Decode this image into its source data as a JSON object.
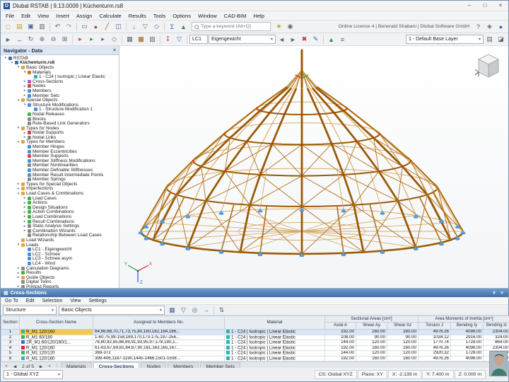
{
  "window": {
    "title": "Dlubal RSTAB | 9.13.0009 | Küchenturm.rs8",
    "logo": "D",
    "controls": [
      {
        "n": "minimize",
        "g": "–"
      },
      {
        "n": "maximize",
        "g": "□"
      },
      {
        "n": "close",
        "g": "×"
      }
    ]
  },
  "menu": [
    "File",
    "Edit",
    "View",
    "Insert",
    "Assign",
    "Calculate",
    "Results",
    "Tools",
    "Options",
    "Window",
    "CAD-BIM",
    "Help"
  ],
  "toolbar1": {
    "search_placeholder": "Type a keyword (Alt+Q)",
    "license": "Online License 4 | Benerald Shabani | Dlubal Software GmbH",
    "icons_left": [
      {
        "n": "new-model",
        "g": "□",
        "c": "#c8821e"
      },
      {
        "n": "open-model",
        "g": "▤",
        "c": "#c8a21e"
      },
      {
        "n": "save",
        "g": "▣",
        "c": "#46689a"
      },
      {
        "n": "print",
        "g": "▥",
        "c": "#5a6672"
      },
      {
        "n": "sep"
      },
      {
        "n": "undo",
        "g": "↶",
        "c": "#46689a"
      },
      {
        "n": "redo",
        "g": "↷",
        "c": "#9aa4ae"
      },
      {
        "n": "sep"
      },
      {
        "n": "select-objects",
        "g": "▭",
        "c": "#5a6672"
      },
      {
        "n": "new-node",
        "g": "●",
        "c": "#c04343"
      },
      {
        "n": "new-member",
        "g": "╱",
        "c": "#9a5c0a"
      },
      {
        "n": "new-section",
        "g": "◫",
        "c": "#46689a"
      },
      {
        "n": "sep"
      },
      {
        "n": "new-load",
        "g": "↓",
        "c": "#c04343"
      },
      {
        "n": "new-support",
        "g": "▽",
        "c": "#3a8a4a"
      },
      {
        "n": "new-hinge",
        "g": "◇",
        "c": "#46689a"
      },
      {
        "n": "sep"
      },
      {
        "n": "calculate-all",
        "g": "Σ",
        "c": "#2f6fb0"
      },
      {
        "n": "show-results",
        "g": "▲",
        "c": "#3a8a4a"
      }
    ],
    "icons_mid": [
      {
        "n": "favorites",
        "g": "★",
        "c": "#c8a21e"
      },
      {
        "n": "snapshot",
        "g": "◉",
        "c": "#5a6672"
      }
    ],
    "icons_right": [
      {
        "n": "help",
        "g": "?",
        "c": "#2f6fb0"
      },
      {
        "n": "info",
        "g": "◈",
        "c": "#5a6672"
      },
      {
        "n": "user-account",
        "g": "●",
        "c": "#46689a"
      }
    ]
  },
  "toolbar2": {
    "lc_label": "LC1",
    "lc_value": "Eigengewicht",
    "layer_value": "1 - Default Base Layer",
    "icons_left": [
      {
        "n": "pointer",
        "g": "►",
        "c": "#5a6672"
      },
      {
        "n": "pan-view",
        "g": "↔",
        "c": "#5a6672"
      },
      {
        "n": "orbit-view",
        "g": "↻",
        "c": "#5a6672"
      },
      {
        "n": "zoom-in",
        "g": "⊕",
        "c": "#5a6672"
      },
      {
        "n": "zoom-out",
        "g": "⊖",
        "c": "#5a6672"
      },
      {
        "n": "zoom-window",
        "g": "⊞",
        "c": "#5a6672"
      },
      {
        "n": "sep"
      },
      {
        "n": "view-x",
        "g": "▸",
        "c": "#c04343"
      },
      {
        "n": "view-y",
        "g": "▸",
        "c": "#3a8a4a"
      },
      {
        "n": "view-z",
        "g": "▸",
        "c": "#2f6fb0"
      },
      {
        "n": "isometric-view",
        "g": "◇",
        "c": "#5a6672"
      },
      {
        "n": "sep"
      },
      {
        "n": "wireframe-display",
        "g": "▦",
        "c": "#5a6672"
      },
      {
        "n": "solid-display",
        "g": "▩",
        "c": "#9a5c0a"
      },
      {
        "n": "transparent-display",
        "g": "▨",
        "c": "#5a6672"
      },
      {
        "n": "sep"
      },
      {
        "n": "show-loads",
        "g": "↧",
        "c": "#c04343"
      },
      {
        "n": "show-supports",
        "g": "▽",
        "c": "#2f6fb0"
      },
      {
        "n": "sep"
      }
    ],
    "icons_mid": [
      {
        "n": "previous-loadcase",
        "g": "◄",
        "c": "#5a6672"
      },
      {
        "n": "next-loadcase",
        "g": "►",
        "c": "#5a6672"
      },
      {
        "n": "delete-loadcase",
        "g": "✖",
        "c": "#c03333"
      },
      {
        "n": "edit-loadcases",
        "g": "✎",
        "c": "#5a6672"
      },
      {
        "n": "sep"
      },
      {
        "n": "show-result-diagrams",
        "g": "▲",
        "c": "#3a8a4a"
      },
      {
        "n": "result-table",
        "g": "≡",
        "c": "#5a6672"
      }
    ],
    "icons_right": [
      {
        "n": "layer-settings",
        "g": "▤",
        "c": "#5a6672"
      },
      {
        "n": "clipping-plane",
        "g": "◪",
        "c": "#5a6672"
      }
    ]
  },
  "navigator": {
    "title": "Navigator - Data",
    "tree": [
      {
        "l": 0,
        "e": "-",
        "c": "#3a6fb0",
        "t": "RSTAB"
      },
      {
        "l": 1,
        "e": "-",
        "c": "#3a6fb0",
        "t": "Küchenturm.rs8",
        "b": true
      },
      {
        "l": 2,
        "e": "-",
        "c": "#e8a33d",
        "t": "Basic Objects"
      },
      {
        "l": 3,
        "e": "-",
        "c": "#cc7a29",
        "t": "Materials"
      },
      {
        "l": 4,
        "e": "",
        "c": "#2ab5b0",
        "t": "1 - C24 | Isotropic | Linear Elastic"
      },
      {
        "l": 3,
        "e": "+",
        "c": "#b05cc4",
        "t": "Cross-Sections"
      },
      {
        "l": 3,
        "e": "+",
        "c": "#d04545",
        "t": "Nodes"
      },
      {
        "l": 3,
        "e": "+",
        "c": "#4a90d9",
        "t": "Members"
      },
      {
        "l": 3,
        "e": "+",
        "c": "#4a90d9",
        "t": "Member Sets"
      },
      {
        "l": 2,
        "e": "-",
        "c": "#e8a33d",
        "t": "Special Objects"
      },
      {
        "l": 3,
        "e": "-",
        "c": "#4a90d9",
        "t": "Structure Modifications"
      },
      {
        "l": 4,
        "e": "",
        "c": "#4a90d9",
        "t": "1 - Structure Modification 1"
      },
      {
        "l": 3,
        "e": "",
        "c": "#3cb44b",
        "t": "Nodal Releases"
      },
      {
        "l": 3,
        "e": "",
        "c": "#888888",
        "t": "Blocks"
      },
      {
        "l": 3,
        "e": "",
        "c": "#888888",
        "t": "Rule-Based Link Generators"
      },
      {
        "l": 2,
        "e": "-",
        "c": "#e8a33d",
        "t": "Types for Nodes"
      },
      {
        "l": 3,
        "e": "+",
        "c": "#d04545",
        "t": "Nodal Supports"
      },
      {
        "l": 3,
        "e": "+",
        "c": "#888888",
        "t": "Nodal Links"
      },
      {
        "l": 2,
        "e": "-",
        "c": "#e8a33d",
        "t": "Types for Members"
      },
      {
        "l": 3,
        "e": "",
        "c": "#4a90d9",
        "t": "Member Hinges"
      },
      {
        "l": 3,
        "e": "",
        "c": "#4a90d9",
        "t": "Member Eccentricities"
      },
      {
        "l": 3,
        "e": "",
        "c": "#d04545",
        "t": "Member Supports"
      },
      {
        "l": 3,
        "e": "",
        "c": "#4a90d9",
        "t": "Member Stiffness Modifications"
      },
      {
        "l": 3,
        "e": "",
        "c": "#888888",
        "t": "Member Nonlinearities"
      },
      {
        "l": 3,
        "e": "",
        "c": "#4a90d9",
        "t": "Member Definable Stiffnesses"
      },
      {
        "l": 3,
        "e": "",
        "c": "#4a90d9",
        "t": "Member Result Intermediate Points"
      },
      {
        "l": 3,
        "e": "",
        "c": "#888888",
        "t": "Member Springs"
      },
      {
        "l": 2,
        "e": "+",
        "c": "#e8a33d",
        "t": "Types for Special Objects"
      },
      {
        "l": 2,
        "e": "+",
        "c": "#e8a33d",
        "t": "Imperfections"
      },
      {
        "l": 2,
        "e": "-",
        "c": "#e8a33d",
        "t": "Load Cases & Combinations"
      },
      {
        "l": 3,
        "e": "+",
        "c": "#3cb44b",
        "t": "Load Cases"
      },
      {
        "l": 3,
        "e": "+",
        "c": "#3cb44b",
        "t": "Actions"
      },
      {
        "l": 3,
        "e": "+",
        "c": "#3cb44b",
        "t": "Design Situations"
      },
      {
        "l": 3,
        "e": "+",
        "c": "#3cb44b",
        "t": "Action Combinations"
      },
      {
        "l": 3,
        "e": "+",
        "c": "#3cb44b",
        "t": "Load Combinations"
      },
      {
        "l": 3,
        "e": "+",
        "c": "#3cb44b",
        "t": "Result Combinations"
      },
      {
        "l": 3,
        "e": "+",
        "c": "#888888",
        "t": "Static Analysis Settings"
      },
      {
        "l": 3,
        "e": "+",
        "c": "#888888",
        "t": "Combination Wizards"
      },
      {
        "l": 3,
        "e": "",
        "c": "#888888",
        "t": "Relationship Between Load Cases"
      },
      {
        "l": 2,
        "e": "",
        "c": "#e8a33d",
        "t": "Load Wizards"
      },
      {
        "l": 2,
        "e": "-",
        "c": "#e8a33d",
        "t": "Loads"
      },
      {
        "l": 3,
        "e": "",
        "c": "#4a90d9",
        "t": "LC1 - Eigengewicht"
      },
      {
        "l": 3,
        "e": "",
        "c": "#4a90d9",
        "t": "LC2 - Schnee"
      },
      {
        "l": 3,
        "e": "",
        "c": "#4a90d9",
        "t": "LC3 - Schnee asym"
      },
      {
        "l": 3,
        "e": "",
        "c": "#4a90d9",
        "t": "LC4 - Wind"
      },
      {
        "l": 2,
        "e": "+",
        "c": "#888888",
        "t": "Calculation Diagrams"
      },
      {
        "l": 2,
        "e": "+",
        "c": "#3cb44b",
        "t": "Results"
      },
      {
        "l": 2,
        "e": "+",
        "c": "#e8a33d",
        "t": "Guide Objects"
      },
      {
        "l": 2,
        "e": "",
        "c": "#888888",
        "t": "Digital Twins"
      },
      {
        "l": 2,
        "e": "+",
        "c": "#888888",
        "t": "Printout Reports"
      }
    ]
  },
  "viewport": {
    "axis_x": "X",
    "axis_y": "Y",
    "axis_z": "Z",
    "colors": {
      "wood_dark": "#9a5a08",
      "wood_mid": "#b06f15",
      "wood_light": "#d8ab66",
      "support": "#2a6ea8",
      "support_light": "#4da2e8",
      "load": "#dd2211"
    }
  },
  "panel": {
    "title": "Cross-Sections",
    "header_icon": "▦",
    "header_buttons": [
      {
        "n": "dock",
        "g": "▾"
      },
      {
        "n": "close-panel",
        "g": "×"
      }
    ],
    "menu": [
      "Go To",
      "Edit",
      "Selection",
      "View",
      "Settings"
    ],
    "combo1": "Structure",
    "combo2": "Basic Objects",
    "icons": [
      {
        "n": "table-settings",
        "g": "▦",
        "c": "#46689a"
      },
      {
        "n": "filter-rows",
        "g": "▽",
        "c": "#5a6672"
      },
      {
        "n": "search-table",
        "g": "◎",
        "c": "#5a6672"
      },
      {
        "n": "export-table",
        "g": "→",
        "c": "#3a8a4a"
      },
      {
        "n": "sep"
      },
      {
        "n": "expand-table",
        "g": "⇅",
        "c": "#5a6672"
      }
    ],
    "table": {
      "main_headers": [
        "Section No.",
        "Cross-Section Name",
        "Assigned to Members No.",
        "Material"
      ],
      "groups": [
        "Sectional Areas [cm²]",
        "Area Moments of Inertia [cm⁴]"
      ],
      "sub_headers": [
        "Axial A",
        "Shear Ay",
        "Shear Az",
        "Torsion J",
        "Bending Iy",
        "Bending Iz"
      ],
      "rows": [
        {
          "no": "1",
          "color": "#2ab5b0",
          "name": "R_M1 120/160",
          "assigned": "64,66,68,70,71,73,75,80,160,162,164,166...",
          "material": "1 - C24 | Isotropic | Linear Elastic",
          "mat_color": "#2ab5b0",
          "axial": "192.00",
          "shear_ay": "160.00",
          "shear_az": "160.00",
          "torsion": "4976.26",
          "bending_iy": "4096.00",
          "bending_iz": "2304.00",
          "selected": true
        },
        {
          "no": "2",
          "color": "#3cb44b",
          "name": "R_M1 60/180",
          "assigned": "1-60,75,99-158,169,170,173-175,197-256...",
          "material": "1 - C24 | Isotropic | Linear Elastic",
          "mat_color": "#2ab5b0",
          "axial": "108.00",
          "shear_ay": "90.00",
          "shear_az": "90.00",
          "torsion": "1034.12",
          "bending_iy": "2916.00",
          "bending_iz": "324.00"
        },
        {
          "no": "3",
          "color": "#4363d8",
          "name": "2R_M1 60/120/160/1...",
          "assigned": "76,80,82,85,86,89,91,93,95,97,178,180,1...",
          "material": "1 - C24 | Isotropic | Linear Elastic",
          "mat_color": "#2ab5b0",
          "axial": "144.00",
          "shear_ay": "120.00",
          "shear_az": "120.00",
          "torsion": "1770.74",
          "bending_iy": "1728.00",
          "bending_iz": "864.00"
        },
        {
          "no": "4",
          "color": "#e6194b",
          "name": "R_M1 120/160",
          "assigned": "61-63,67,69,81,84,87,90,161,163,165,167...",
          "material": "1 - C24 | Isotropic | Linear Elastic",
          "mat_color": "#2ab5b0",
          "axial": "192.00",
          "shear_ay": "160.00",
          "shear_az": "160.00",
          "torsion": "4976.26",
          "bending_iy": "4096.00",
          "bending_iz": "2304.00"
        },
        {
          "no": "5",
          "color": "#3cb44b",
          "name": "R_M1 120/120",
          "assigned": "369-372",
          "material": "1 - C24 | Isotropic | Linear Elastic",
          "mat_color": "#2ab5b0",
          "axial": "144.00",
          "shear_ay": "120.00",
          "shear_az": "120.00",
          "torsion": "2920.32",
          "bending_iy": "1728.00",
          "bending_iz": "1728.00"
        },
        {
          "no": "6",
          "color": "#2ab5b0",
          "name": "R_M1 120/160",
          "assigned": "399-406,1187-1190,1445-1466,1501-1508...",
          "material": "1 - C24 | Isotropic | Linear Elastic",
          "mat_color": "#2ab5b0",
          "axial": "192.00",
          "shear_ay": "160.00",
          "shear_az": "160.00",
          "torsion": "4976.26",
          "bending_iy": "4096.00",
          "bending_iz": "2304.00"
        }
      ]
    },
    "pager": {
      "first": "«",
      "prev": "◀",
      "label": "2 of 5",
      "next": "▶",
      "last": "»"
    },
    "tabs": [
      {
        "label": "Materials"
      },
      {
        "label": "Cross-Sections",
        "active": true
      },
      {
        "label": "Nodes"
      },
      {
        "label": "Members"
      },
      {
        "label": "Member Sets"
      }
    ]
  },
  "statusbar": {
    "left": "1 - Global XYZ",
    "fields": [
      "CS: Global XYZ",
      "Plane: XY",
      "X: -2.139 m",
      "Y: 7.400 m",
      "Z: 0.000 m"
    ]
  }
}
